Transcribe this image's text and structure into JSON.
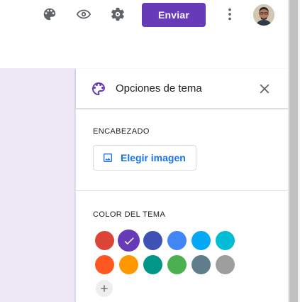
{
  "header": {
    "send_label": "Enviar",
    "accent_color": "#673ab7",
    "icons": [
      "palette-icon",
      "eye-icon",
      "gear-icon",
      "more-vert-icon"
    ]
  },
  "theme_panel": {
    "title": "Opciones de tema",
    "header_section": {
      "label": "ENCABEZADO",
      "choose_image_label": "Elegir imagen"
    },
    "color_section": {
      "label": "COLOR DEL TEMA",
      "selected_color": "#673ab7",
      "colors": [
        "#db4437",
        "#673ab7",
        "#3f51b5",
        "#4285f4",
        "#03a9f4",
        "#00bcd4",
        "#ff5722",
        "#ff9800",
        "#009688",
        "#4caf50",
        "#607d8b",
        "#9e9e9e"
      ]
    }
  }
}
